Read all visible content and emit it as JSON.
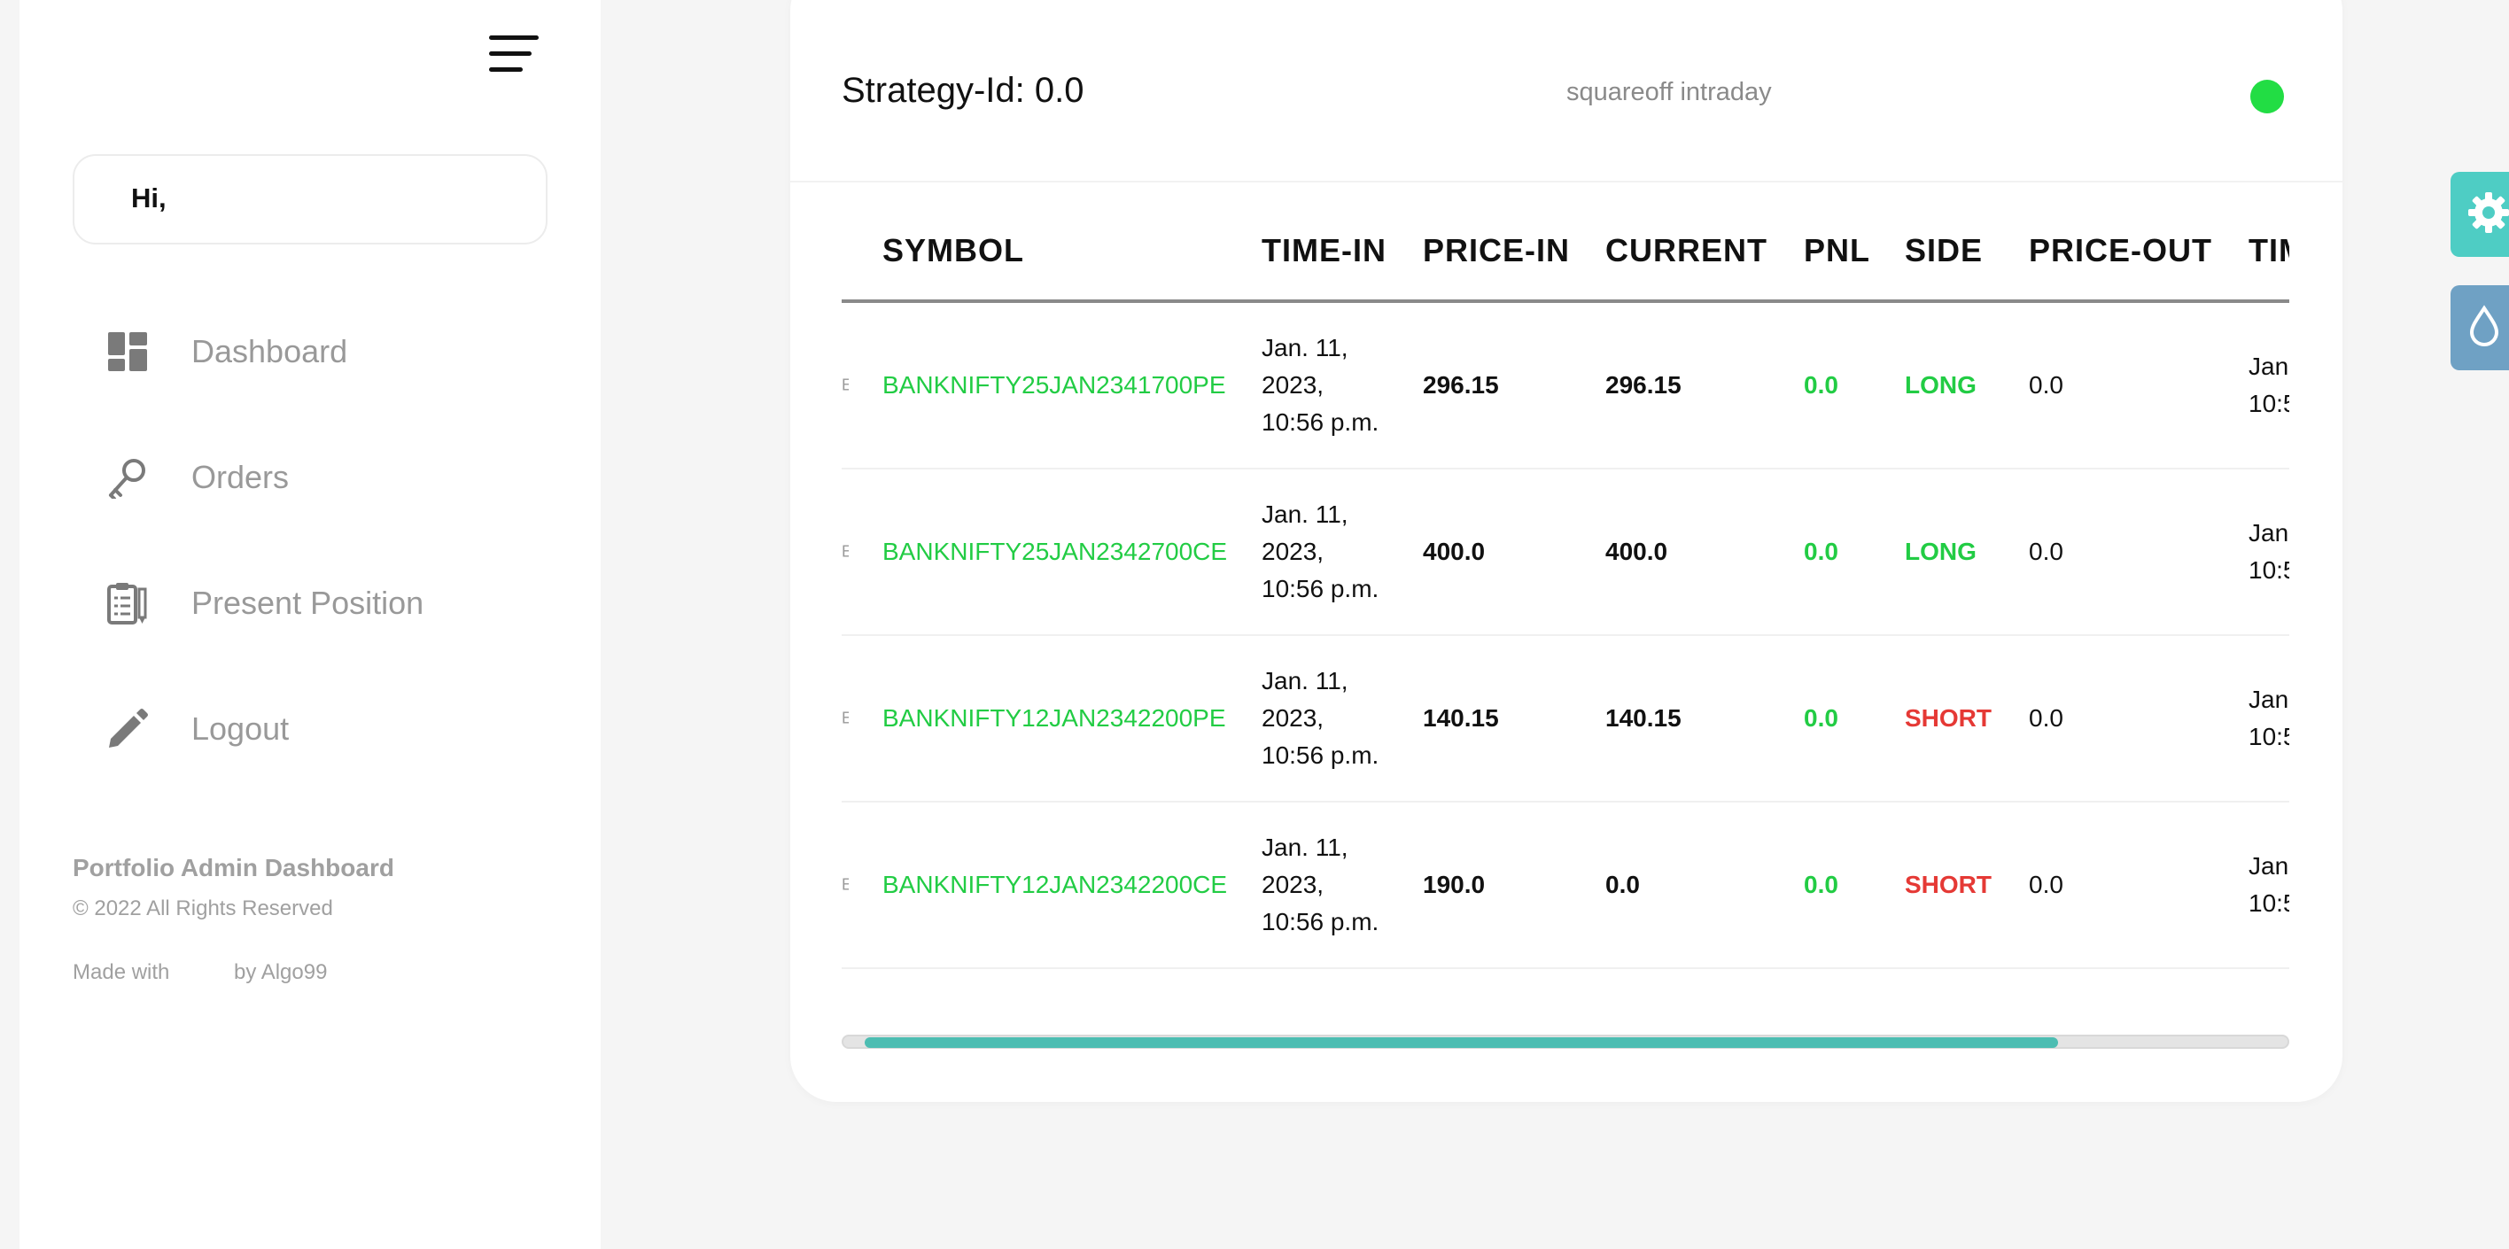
{
  "sidebar": {
    "greeting": "Hi,",
    "items": [
      {
        "label": "Dashboard",
        "icon": "dashboard-icon"
      },
      {
        "label": "Orders",
        "icon": "key-icon"
      },
      {
        "label": "Present Position",
        "icon": "clipboard-icon"
      },
      {
        "label": "Logout",
        "icon": "pencil-icon"
      }
    ],
    "footer": {
      "title": "Portfolio Admin Dashboard",
      "copyright": "© 2022 All Rights Reserved",
      "made_with": "Made with",
      "by": "by Algo99"
    }
  },
  "card": {
    "title": "Strategy-Id: 0.0",
    "subtitle": "squareoff intraday",
    "status_color": "#22dd44"
  },
  "table": {
    "columns": [
      "SYMBOL",
      "TIME-IN",
      "PRICE-IN",
      "CURRENT",
      "PNL",
      "SIDE",
      "PRICE-OUT",
      "TIM"
    ],
    "rows": [
      {
        "stub": "E",
        "symbol": "BANKNIFTY25JAN2341700PE",
        "time_in": "Jan. 11,\n2023,\n10:56 p.m.",
        "price_in": "296.15",
        "current": "296.15",
        "pnl": "0.0",
        "side": "LONG",
        "price_out": "0.0",
        "time_out": "Jan\n10:5"
      },
      {
        "stub": "E",
        "symbol": "BANKNIFTY25JAN2342700CE",
        "time_in": "Jan. 11,\n2023,\n10:56 p.m.",
        "price_in": "400.0",
        "current": "400.0",
        "pnl": "0.0",
        "side": "LONG",
        "price_out": "0.0",
        "time_out": "Jan\n10:5"
      },
      {
        "stub": "E",
        "symbol": "BANKNIFTY12JAN2342200PE",
        "time_in": "Jan. 11,\n2023,\n10:56 p.m.",
        "price_in": "140.15",
        "current": "140.15",
        "pnl": "0.0",
        "side": "SHORT",
        "price_out": "0.0",
        "time_out": "Jan\n10:5"
      },
      {
        "stub": "E",
        "symbol": "BANKNIFTY12JAN2342200CE",
        "time_in": "Jan. 11,\n2023,\n10:56 p.m.",
        "price_in": "190.0",
        "current": "0.0",
        "pnl": "0.0",
        "side": "SHORT",
        "price_out": "0.0",
        "time_out": "Jan\n10:5"
      }
    ],
    "horizontal_scroll_fraction": 0.84
  },
  "floating_buttons": [
    {
      "icon": "gear-icon",
      "color": "#4ecdc4"
    },
    {
      "icon": "droplet-icon",
      "color": "#6fa1c4"
    }
  ],
  "colors": {
    "symbol": "#22cc44",
    "pnl": "#22cc44",
    "long": "#22cc44",
    "short": "#e53935",
    "scroll_thumb": "#4dbdb2"
  }
}
